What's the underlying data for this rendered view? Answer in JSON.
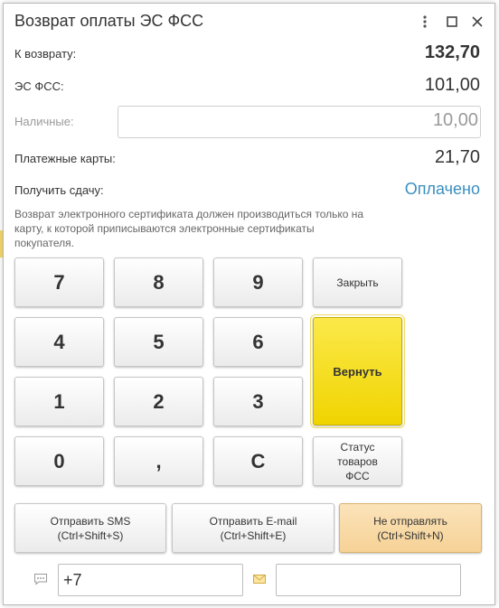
{
  "window": {
    "title": "Возврат оплаты ЭС ФСС",
    "menu_icon": "more-vert-icon",
    "maximize_icon": "maximize-icon",
    "close_icon": "close-icon"
  },
  "summary": {
    "refund_label": "К возврату:",
    "refund_value": "132,70",
    "es_fss_label": "ЭС ФСС:",
    "es_fss_value": "101,00",
    "cash_label": "Наличные:",
    "cash_value": "10,00",
    "cards_label": "Платежные карты:",
    "cards_value": "21,70",
    "change_label": "Получить сдачу:",
    "status_value": "Оплачено"
  },
  "hint": "Возврат электронного сертификата должен производиться только на карту, к которой приписываются электронные сертификаты покупателя.",
  "keypad": {
    "k7": "7",
    "k8": "8",
    "k9": "9",
    "k4": "4",
    "k5": "5",
    "k6": "6",
    "k1": "1",
    "k2": "2",
    "k3": "3",
    "k0": "0",
    "comma": ",",
    "clear": "C",
    "close": "Закрыть",
    "refund": "Вернуть",
    "status_line1": "Статус",
    "status_line2": "товаров",
    "status_line3": "ФСС"
  },
  "send": {
    "sms_line1": "Отправить SMS",
    "sms_line2": "(Ctrl+Shift+S)",
    "email_line1": "Отправить E-mail",
    "email_line2": "(Ctrl+Shift+E)",
    "none_line1": "Не отправлять",
    "none_line2": "(Ctrl+Shift+N)"
  },
  "contacts": {
    "phone_value": "+7",
    "email_value": "",
    "phone_icon": "sms-icon",
    "email_icon": "envelope-icon"
  },
  "colors": {
    "accent_yellow": "#f5dc1a",
    "status_blue": "#3a8fbf",
    "selected_orange": "#f8d9a6"
  }
}
